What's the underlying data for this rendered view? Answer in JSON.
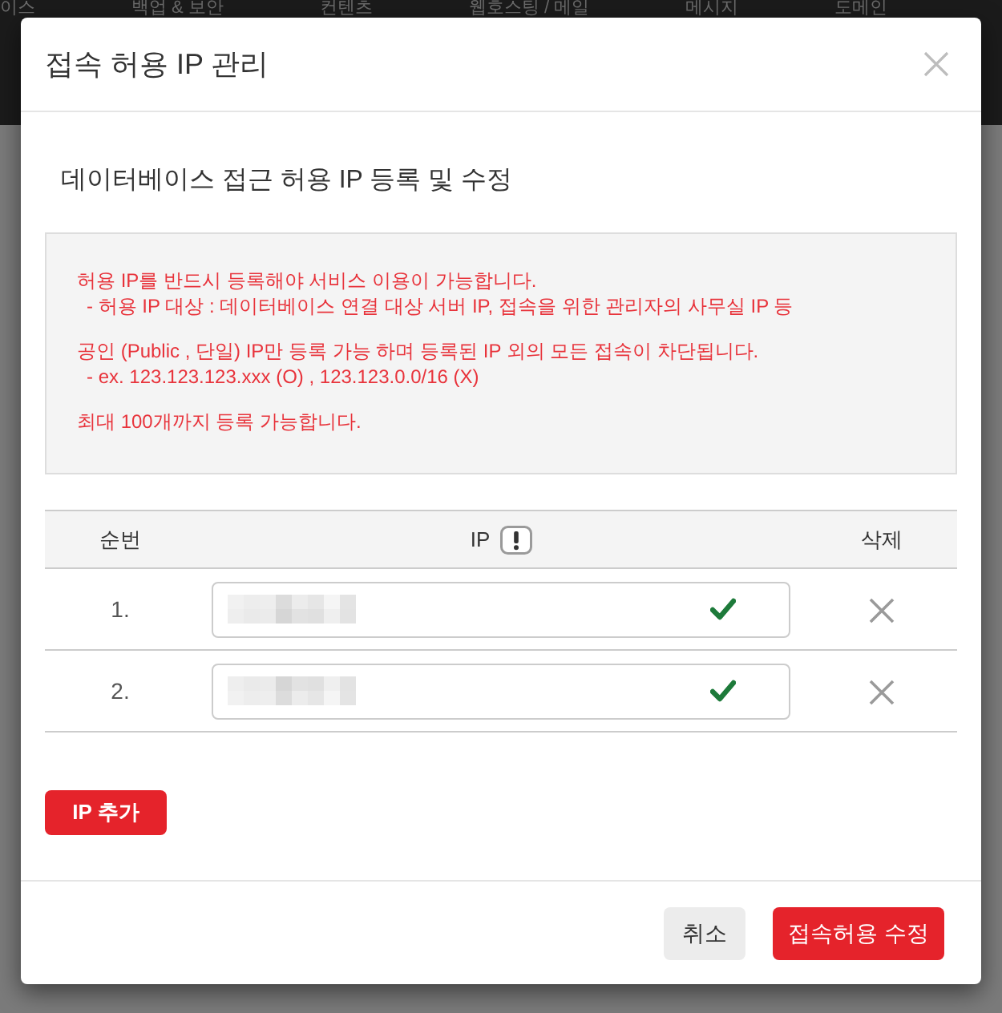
{
  "background_nav": {
    "items": [
      "이스",
      "백업 & 보안",
      "컨텐츠",
      "웹호스팅 / 메일",
      "메시지",
      "도메인"
    ]
  },
  "dialog": {
    "title": "접속 허용 IP 관리",
    "subtitle": "데이터베이스 접근 허용 IP 등록 및 수정",
    "notice": [
      [
        {
          "kind": "main",
          "text": "허용 IP를 반드시 등록해야 서비스 이용이 가능합니다."
        },
        {
          "kind": "sub",
          "text": "- 허용 IP 대상 : 데이터베이스 연결 대상 서버 IP, 접속을 위한 관리자의 사무실 IP 등"
        }
      ],
      [
        {
          "kind": "main",
          "text": "공인 (Public , 단일) IP만 등록 가능 하며 등록된 IP 외의 모든 접속이 차단됩니다."
        },
        {
          "kind": "sub",
          "text": "- ex. 123.123.123.xxx (O) , 123.123.0.0/16 (X)"
        }
      ],
      [
        {
          "kind": "main",
          "text": "최대 100개까지 등록 가능합니다."
        }
      ]
    ],
    "table": {
      "columns": [
        {
          "label": "순번",
          "info": false
        },
        {
          "label": "IP",
          "info": true
        },
        {
          "label": "삭제",
          "info": false
        }
      ],
      "rows": [
        {
          "number": "1.",
          "valid": true
        },
        {
          "number": "2.",
          "valid": true
        }
      ]
    },
    "add_button": "IP 추가",
    "footer_buttons": [
      {
        "label": "취소",
        "kind": "secondary"
      },
      {
        "label": "접속허용 수정",
        "kind": "primary"
      }
    ]
  }
}
